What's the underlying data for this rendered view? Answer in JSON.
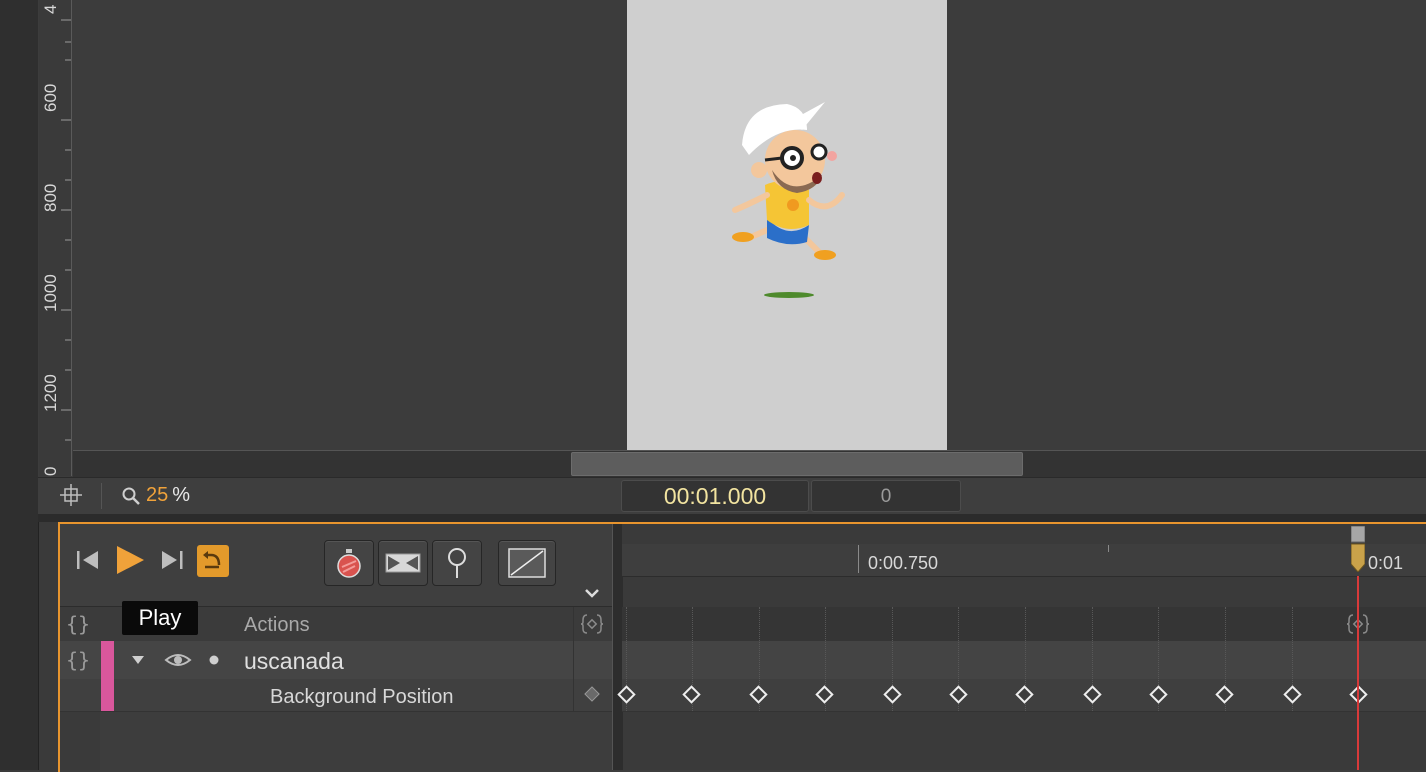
{
  "stage": {
    "ruler_labels": [
      "4",
      "600",
      "800",
      "1000",
      "1200",
      "0"
    ]
  },
  "status_bar": {
    "zoom_value": "25",
    "zoom_unit": "%",
    "time": "00:01.000",
    "frame": "0"
  },
  "timeline": {
    "tooltip": "Play",
    "rows": {
      "actions_label": "Actions",
      "layer_name": "uscanada",
      "property_name": "Background Position"
    },
    "time_labels": {
      "mid": "0:00.750",
      "end": "0:01"
    },
    "colors": {
      "accent": "#e8952e",
      "layer_color": "#d9579c",
      "playhead": "#d83a3a",
      "play": "#f0a23a"
    },
    "icons": [
      "skip-to-start-icon",
      "play-icon",
      "skip-to-end-icon",
      "loop-icon",
      "stopwatch-icon",
      "auto-transition-icon",
      "pin-icon",
      "easing-curve-icon",
      "chevron-down-icon",
      "eye-icon",
      "lock-dot-icon"
    ]
  }
}
